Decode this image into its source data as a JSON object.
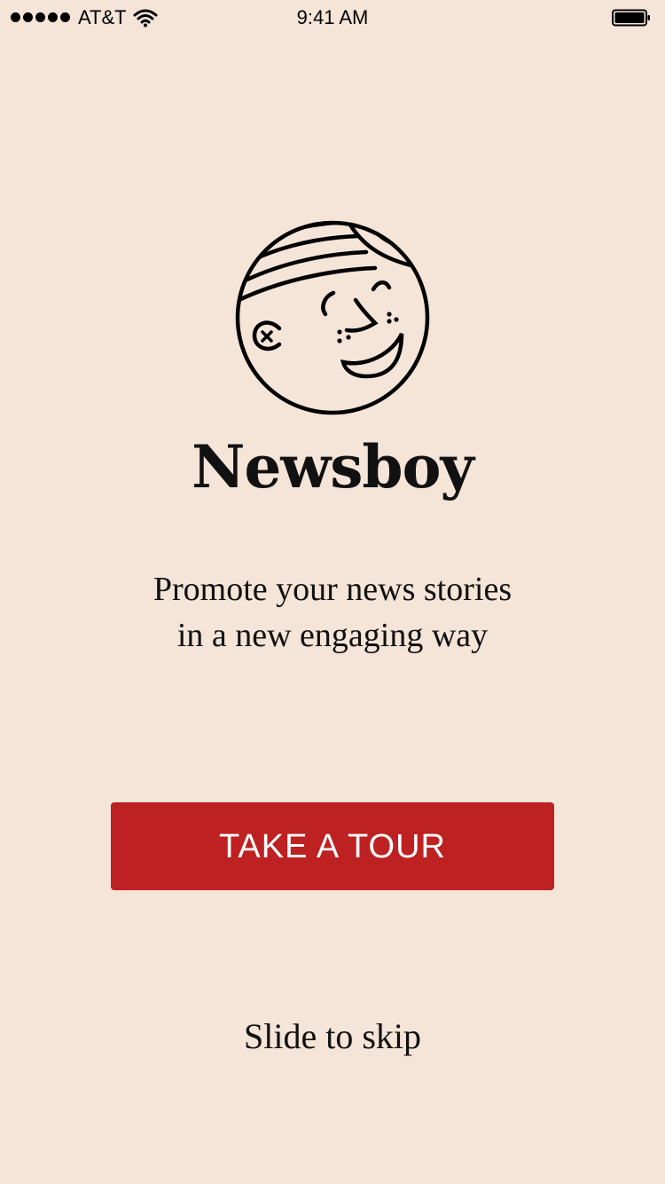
{
  "status_bar": {
    "carrier": "AT&T",
    "time": "9:41 AM",
    "signal_icon": "signal-dots-icon",
    "wifi_icon": "wifi-icon",
    "battery_icon": "battery-icon",
    "battery_level": 1.0
  },
  "app": {
    "logo_icon": "newsboy-face-logo",
    "title": "Newsboy",
    "tagline_line1": "Promote your news stories",
    "tagline_line2": "in a new engaging way"
  },
  "actions": {
    "tour_label": "TAKE A TOUR",
    "skip_label": "Slide to skip"
  },
  "colors": {
    "background": "#f5e4d8",
    "accent": "#be2121",
    "text": "#111111"
  }
}
